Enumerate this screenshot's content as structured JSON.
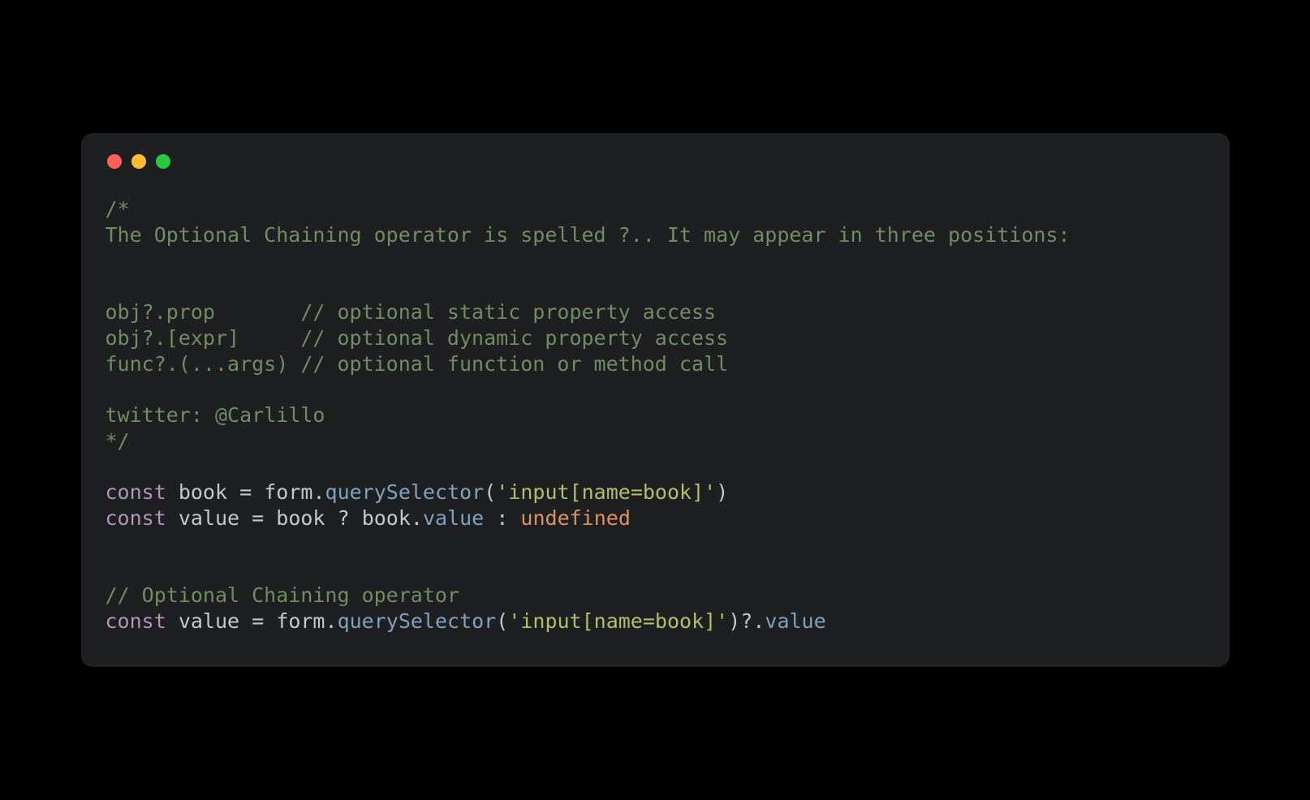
{
  "window": {
    "traffic_lights": [
      "close",
      "minimize",
      "zoom"
    ]
  },
  "code": {
    "block_comment_open": "/*",
    "block_comment_line1": "The Optional Chaining operator is spelled ?.. It may appear in three positions:",
    "example1": "obj?.prop       // optional static property access",
    "example2": "obj?.[expr]     // optional dynamic property access",
    "example3": "func?.(...args) // optional function or method call",
    "credit": "twitter: @Carlillo",
    "block_comment_close": "*/",
    "l1_kw": "const",
    "l1_sp1": " ",
    "l1_var": "book",
    "l1_sp2": " ",
    "l1_eq": "=",
    "l1_sp3": " ",
    "l1_obj": "form",
    "l1_dot": ".",
    "l1_fn": "querySelector",
    "l1_lp": "(",
    "l1_str": "'input[name=book]'",
    "l1_rp": ")",
    "l2_kw": "const",
    "l2_sp1": " ",
    "l2_var": "value",
    "l2_sp2": " ",
    "l2_eq": "=",
    "l2_sp3": " ",
    "l2_cond": "book",
    "l2_sp4": " ",
    "l2_q": "?",
    "l2_sp5": " ",
    "l2_then_obj": "book",
    "l2_then_dot": ".",
    "l2_then_prop": "value",
    "l2_sp6": " ",
    "l2_colon": ":",
    "l2_sp7": " ",
    "l2_undef": "undefined",
    "comment_oc": "// Optional Chaining operator",
    "l3_kw": "const",
    "l3_sp1": " ",
    "l3_var": "value",
    "l3_sp2": " ",
    "l3_eq": "=",
    "l3_sp3": " ",
    "l3_obj": "form",
    "l3_dot": ".",
    "l3_fn": "querySelector",
    "l3_lp": "(",
    "l3_str": "'input[name=book]'",
    "l3_rp": ")",
    "l3_oc": "?.",
    "l3_prop": "value"
  }
}
